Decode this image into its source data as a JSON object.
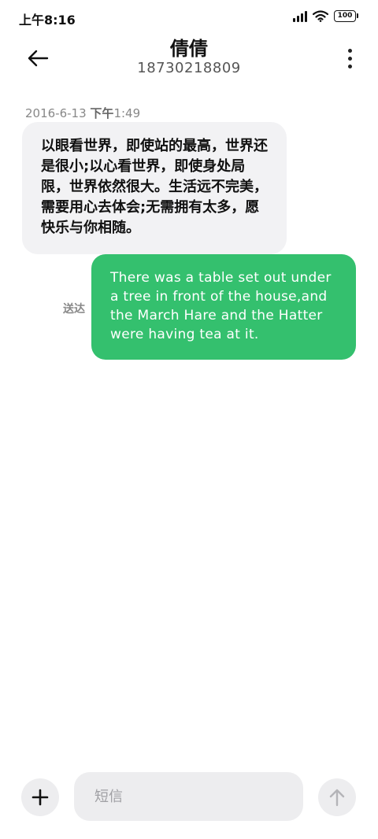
{
  "status_bar": {
    "time": "上午8:16",
    "battery": "100",
    "icons": [
      "signal-icon",
      "wifi-icon",
      "battery-icon"
    ]
  },
  "header": {
    "contact_name": "倩倩",
    "phone_number": "18730218809",
    "icons": [
      "back-arrow-icon",
      "more-vertical-icon"
    ]
  },
  "conversation": {
    "timestamp_date": "2016-6-13",
    "timestamp_period": "下午",
    "timestamp_time": "1:49",
    "received_message": "以眼看世界，即使站的最高，世界还是很小;以心看世界，即使身处局限，世界依然很大。生活远不完美，需要用心去体会;无需拥有太多，愿快乐与你相随。",
    "sent_message": "There was a table set out under a tree in front of the house,and the March Hare and the Hatter were having tea at it.",
    "delivery_status": "送达"
  },
  "composer": {
    "input_placeholder": "短信",
    "input_value": "",
    "icons": [
      "plus-icon",
      "send-arrow-icon"
    ]
  },
  "colors": {
    "sent_bubble": "#34c06e",
    "received_bubble": "#f2f2f4",
    "composer_fill": "#ededef"
  }
}
